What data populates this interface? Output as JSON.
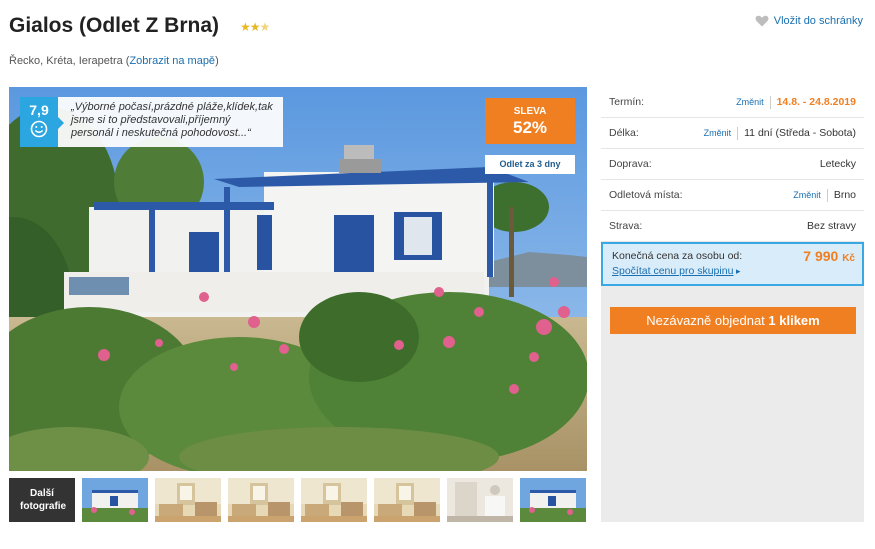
{
  "hotel": {
    "name": "Gialos (Odlet Z Brna)",
    "stars": "2.5",
    "location": "Řecko, Kréta, Ierapetra (",
    "map_link": "Zobrazit na mapě",
    "location_end": ")",
    "favorite_label": "Vložit do schránky"
  },
  "photo": {
    "rating": "7,9",
    "review_quote": "„Výborné počasí,prázdné pláže,klídek,tak jsme si to představovali,příjemný personál i neskutečná pohodovost...“",
    "discount_label": "SLEVA",
    "discount_value": "52%",
    "departure_badge": "Odlet za 3 dny"
  },
  "gallery": {
    "more_label": "Další fotografie",
    "thumbnails": [
      "exterior",
      "room",
      "room",
      "room",
      "room",
      "bathroom",
      "exterior"
    ]
  },
  "booking": {
    "change_label": "Změnit",
    "rows": [
      {
        "label": "Termín:",
        "value": "14.8. - 24.8.2019"
      },
      {
        "label": "Délka:",
        "value": "11 dní (Středa - Sobota)"
      },
      {
        "label": "Doprava:",
        "value": "Letecky"
      },
      {
        "label": "Odletová místa:",
        "value": "Brno"
      },
      {
        "label": "Strava:",
        "value": "Bez stravy"
      }
    ],
    "price_label": "Konečná cena za osobu od:",
    "group_link": "Spočítat cenu pro skupinu",
    "price_amount": "7 990",
    "price_currency": "Kč",
    "order_button_text": "Nezávazně objednat",
    "order_button_strong": "1 klikem"
  },
  "colors": {
    "accent": "#f07f22",
    "link": "#1a6fb0",
    "rating_bg": "#2ba6e1",
    "price_box_bg": "#d9ecf9"
  }
}
